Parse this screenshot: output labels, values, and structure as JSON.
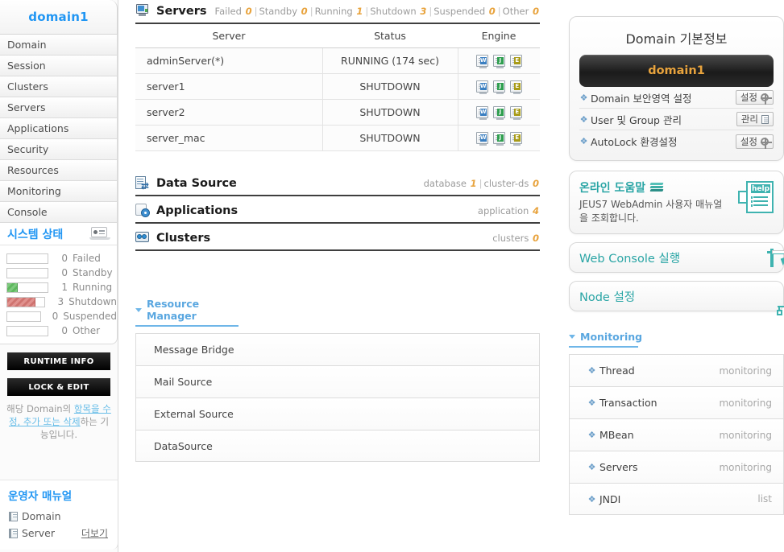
{
  "sidebar": {
    "domain_title": "domain1",
    "nav_items": [
      {
        "label": "Domain"
      },
      {
        "label": "Session"
      },
      {
        "label": "Clusters"
      },
      {
        "label": "Servers"
      },
      {
        "label": "Applications"
      },
      {
        "label": "Security"
      },
      {
        "label": "Resources"
      },
      {
        "label": "Monitoring"
      },
      {
        "label": "Console"
      }
    ],
    "system_status": {
      "title": "시스템 상태",
      "rows": [
        {
          "count": "0",
          "label": "Failed",
          "pct": 0,
          "color": ""
        },
        {
          "count": "0",
          "label": "Standby",
          "pct": 0,
          "color": ""
        },
        {
          "count": "1",
          "label": "Running",
          "pct": 25,
          "color": "green"
        },
        {
          "count": "3",
          "label": "Shutdown",
          "pct": 75,
          "color": "red"
        },
        {
          "count": "0",
          "label": "Suspended",
          "pct": 0,
          "color": ""
        },
        {
          "count": "0",
          "label": "Other",
          "pct": 0,
          "color": ""
        }
      ]
    },
    "runtime_info_label": "RUNTIME INFO",
    "lock_edit_label": "LOCK & EDIT",
    "lock_desc_pre": "해당 Domain의 ",
    "lock_desc_link": "항목을 수정, 추가 또는 삭제",
    "lock_desc_post": "하는 기능입니다.",
    "manual": {
      "title": "운영자 매뉴얼",
      "items": [
        "Domain",
        "Server"
      ],
      "more_label": "더보기"
    }
  },
  "servers_section": {
    "title": "Servers",
    "counts": [
      {
        "label": "Failed",
        "value": "0"
      },
      {
        "label": "Standby",
        "value": "0"
      },
      {
        "label": "Running",
        "value": "1"
      },
      {
        "label": "Shutdown",
        "value": "3"
      },
      {
        "label": "Suspended",
        "value": "0"
      },
      {
        "label": "Other",
        "value": "0"
      }
    ],
    "columns": [
      "Server",
      "Status",
      "Engine"
    ],
    "rows": [
      {
        "name": "adminServer(*)",
        "status": "RUNNING (174 sec)",
        "engines": [
          "web",
          "jeus",
          "ejb"
        ]
      },
      {
        "name": "server1",
        "status": "SHUTDOWN",
        "engines": [
          "web",
          "jeus",
          "ejb"
        ]
      },
      {
        "name": "server2",
        "status": "SHUTDOWN",
        "engines": [
          "web",
          "jeus",
          "ejb"
        ]
      },
      {
        "name": "server_mac",
        "status": "SHUTDOWN",
        "engines": [
          "web",
          "jeus",
          "ejb"
        ]
      }
    ]
  },
  "datasource_section": {
    "title": "Data Source",
    "counts": [
      {
        "label": "database",
        "value": "1"
      },
      {
        "label": "cluster-ds",
        "value": "0"
      }
    ]
  },
  "applications_section": {
    "title": "Applications",
    "counts": [
      {
        "label": "application",
        "value": "4"
      }
    ]
  },
  "clusters_section": {
    "title": "Clusters",
    "counts": [
      {
        "label": "clusters",
        "value": "0"
      }
    ]
  },
  "resource_manager": {
    "title": "Resource Manager",
    "items": [
      {
        "label": "Message Bridge"
      },
      {
        "label": "Mail Source"
      },
      {
        "label": "External Source"
      },
      {
        "label": "DataSource"
      }
    ]
  },
  "domain_info": {
    "title": "Domain 기본정보",
    "domain_name": "domain1",
    "rows": [
      {
        "label": "Domain 보안영역 설정",
        "action": "설정",
        "icon": "gear-icon"
      },
      {
        "label": "User 및 Group 관리",
        "action": "관리",
        "icon": "document-icon"
      },
      {
        "label": "AutoLock 환경설정",
        "action": "설정",
        "icon": "gear-icon"
      }
    ]
  },
  "help_card": {
    "title": "온라인 도움말",
    "description": "JEUS7 WebAdmin 사용자 매뉴얼을 조회합니다.",
    "badge": "help"
  },
  "action_cards": [
    {
      "label": "Web Console 실행",
      "icon": "window-cursor-icon"
    },
    {
      "label": "Node 설정",
      "icon": "node-tree-icon"
    }
  ],
  "monitoring": {
    "title": "Monitoring",
    "items": [
      {
        "label": "Thread",
        "action": "monitoring"
      },
      {
        "label": "Transaction",
        "action": "monitoring"
      },
      {
        "label": "MBean",
        "action": "monitoring"
      },
      {
        "label": "Servers",
        "action": "monitoring"
      },
      {
        "label": "JNDI",
        "action": "list"
      }
    ]
  },
  "colors": {
    "accent_blue": "#2196f3",
    "teal": "#2aa5a5",
    "amber": "#e8a33d",
    "running_green": "#5eb85e",
    "shutdown_red": "#cf7470"
  }
}
